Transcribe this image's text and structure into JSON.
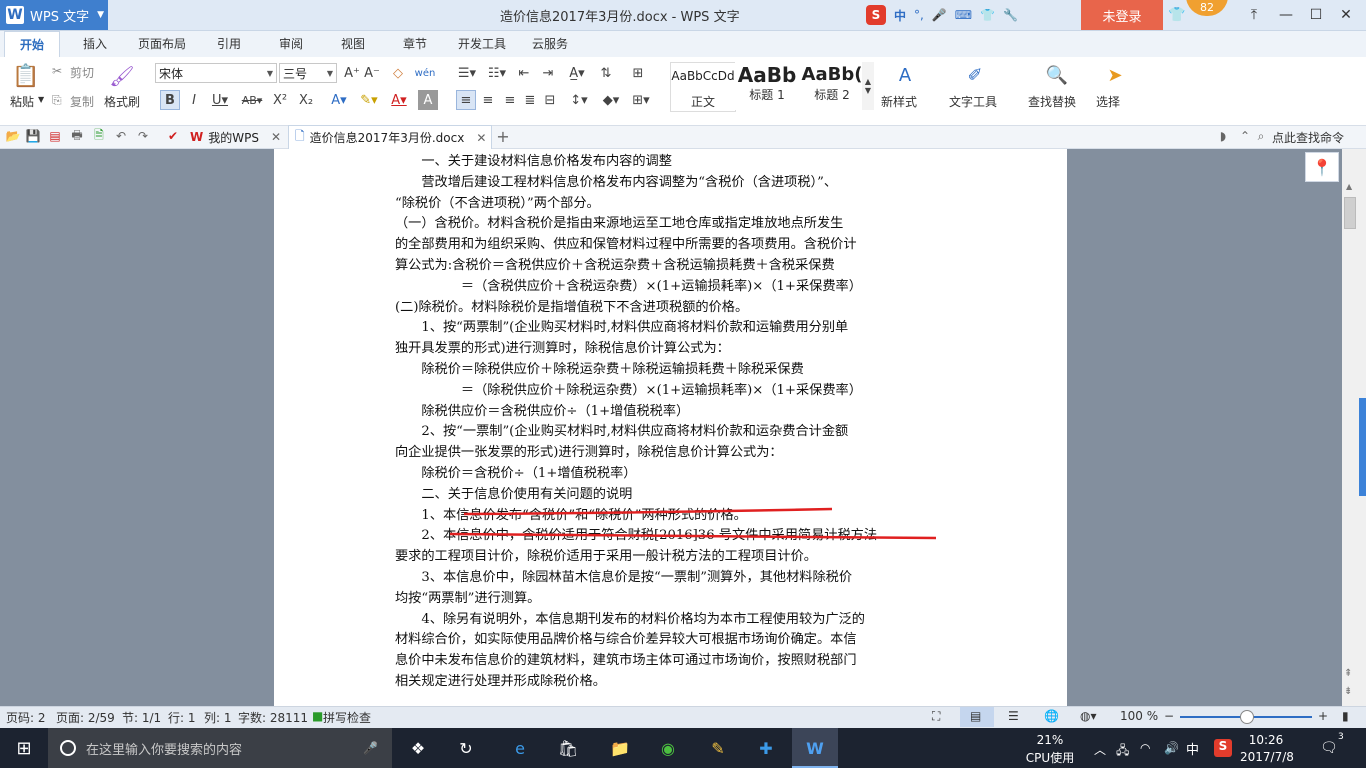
{
  "window": {
    "app_name": "WPS 文字",
    "app_logo": "W",
    "title": "造价信息2017年3月份.docx - WPS 文字",
    "login_label": "未登录",
    "badge_count": "82",
    "sogou": {
      "logo": "S",
      "lang": "中",
      "punct": "°,"
    }
  },
  "menu_tabs": [
    {
      "label": "开始",
      "active": true
    },
    {
      "label": "插入"
    },
    {
      "label": "页面布局"
    },
    {
      "label": "引用"
    },
    {
      "label": "审阅"
    },
    {
      "label": "视图"
    },
    {
      "label": "章节"
    },
    {
      "label": "开发工具"
    },
    {
      "label": "云服务"
    }
  ],
  "ribbon": {
    "paste": "粘贴",
    "cut": "剪切",
    "copy": "复制",
    "format_painter": "格式刷",
    "font_name": "宋体",
    "font_size": "三号",
    "styles": [
      {
        "preview": "AaBbCcDd",
        "label": "正文"
      },
      {
        "preview": "AaBb",
        "label": "标题 1"
      },
      {
        "preview": "AaBb(",
        "label": "标题 2"
      }
    ],
    "new_style": "新样式",
    "text_tools": "文字工具",
    "find_replace": "查找替换",
    "select": "选择"
  },
  "doc_tabs": {
    "my_wps": "我的WPS",
    "active_doc": "造价信息2017年3月份.docx",
    "find_command": "点此查找命令"
  },
  "document": {
    "lines": [
      "　　一、关于建设材料信息价格发布内容的调整",
      "　　营改增后建设工程材料信息价格发布内容调整为“含税价（含进项税）”、",
      "“除税价（不含进项税）”两个部分。",
      "（一）含税价。材料含税价是指由来源地运至工地仓库或指定堆放地点所发生",
      "的全部费用和为组织采购、供应和保管材料过程中所需要的各项费用。含税价计",
      "算公式为:含税价＝含税供应价＋含税运杂费＋含税运输损耗费＋含税采保费",
      "　　　　　＝（含税供应价＋含税运杂费）×(1+运输损耗率)×（1+采保费率）",
      "(二)除税价。材料除税价是指增值税下不含进项税额的价格。",
      "　　1、按“两票制”(企业购买材料时,材料供应商将材料价款和运输费用分别单",
      "独开具发票的形式)进行测算时，除税信息价计算公式为：",
      "　　除税价＝除税供应价＋除税运杂费＋除税运输损耗费＋除税采保费",
      "　　　　　＝（除税供应价＋除税运杂费）×(1+运输损耗率)×（1+采保费率）",
      "　　除税供应价＝含税供应价÷（1+增值税税率）",
      "　　2、按“一票制”(企业购买材料时,材料供应商将材料价款和运杂费合计金额",
      "向企业提供一张发票的形式)进行测算时，除税信息价计算公式为：",
      "　　除税价＝含税价÷（1+增值税税率）",
      "　　二、关于信息价使用有关问题的说明",
      "　　1、本信息价发布“含税价”和“除税价”两种形式的价格。",
      "　　2、本信息价中，含税价适用于符合财税[2016]36 号文件中采用简易计税方法",
      "要求的工程项目计价，除税价适用于采用一般计税方法的工程项目计价。",
      "　　3、本信息价中，除园林苗木信息价是按“一票制”测算外，其他材料除税价",
      "均按“两票制”进行测算。",
      "　　4、除另有说明外，本信息期刊发布的材料价格均为本市工程使用较为广泛的",
      "材料综合价，如实际使用品牌价格与综合价差异较大可根据市场询价确定。本信",
      "息价中未发布信息价的建筑材料，建筑市场主体可通过市场询价，按照财税部门",
      "相关规定进行处理并形成除税价格。"
    ],
    "annotation_color": "#e02020"
  },
  "status": {
    "page_code": "页码: 2",
    "pages": "页面: 2/59",
    "section": "节: 1/1",
    "row": "行: 1",
    "col": "列: 1",
    "word_count": "字数: 28111",
    "spell_check": "拼写检查",
    "zoom": "100 %",
    "zoom_fraction": 0.5
  },
  "taskbar": {
    "search_placeholder": "在这里输入你要搜索的内容",
    "cpu_percent": "21%",
    "cpu_label": "CPU使用",
    "ime": "中",
    "time": "10:26",
    "date": "2017/7/8",
    "notifications": "3"
  }
}
